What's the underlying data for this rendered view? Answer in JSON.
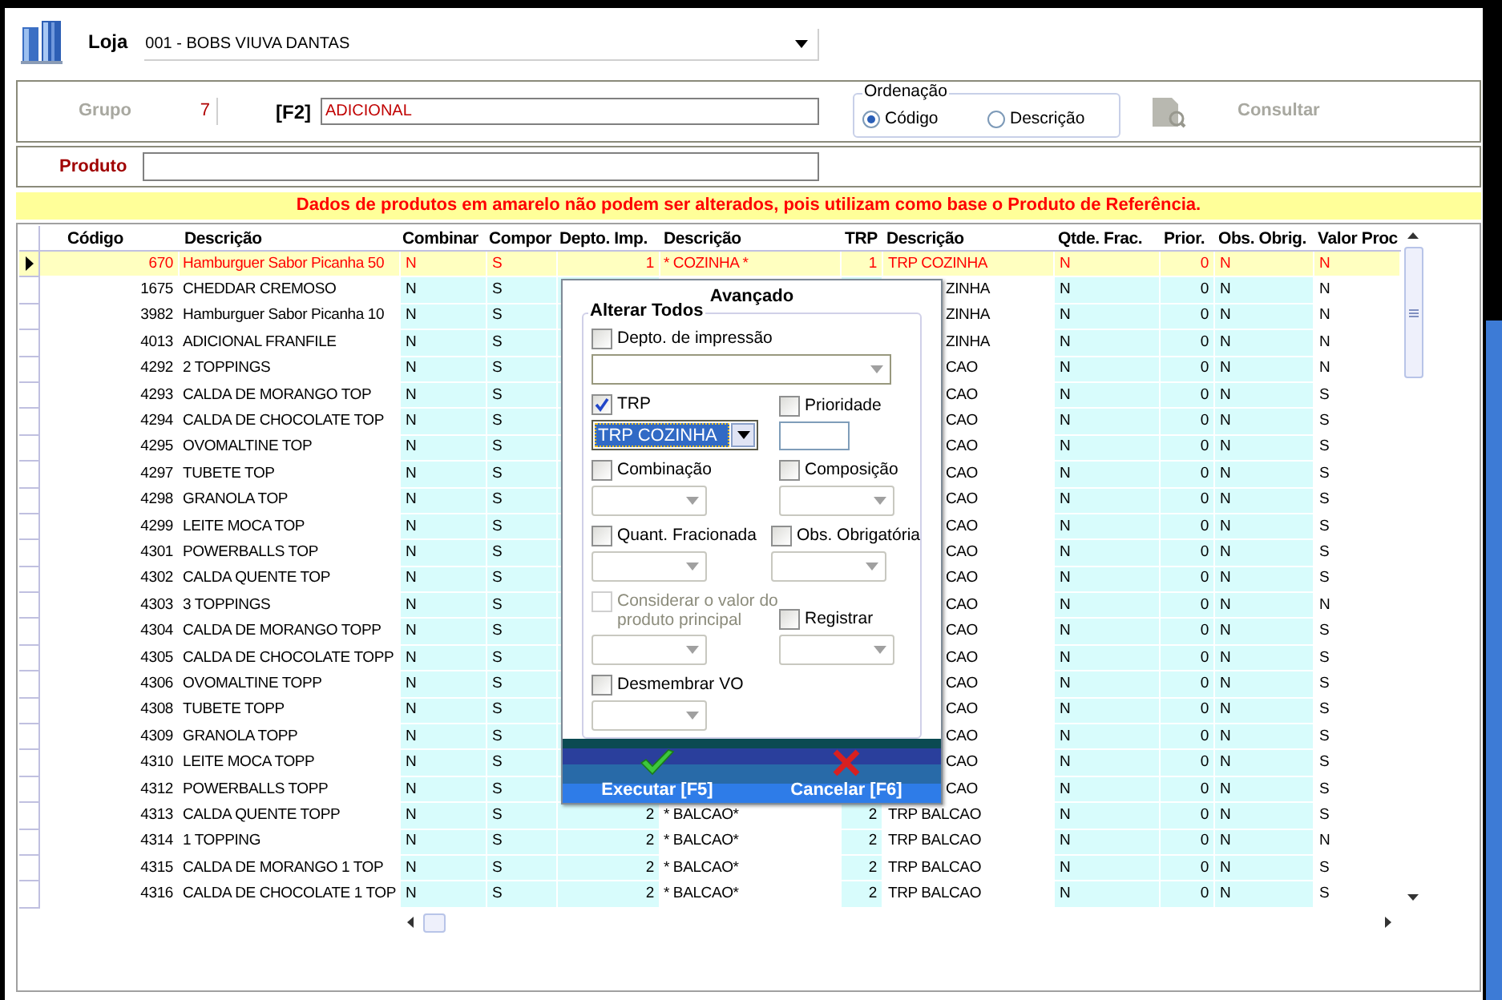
{
  "store": {
    "label": "Loja",
    "value": "001 - BOBS VIUVA DANTAS"
  },
  "filter": {
    "group_label": "Grupo",
    "group_value": "7",
    "shortcut": "[F2]",
    "group_name": "ADICIONAL",
    "ordering": {
      "title": "Ordenação",
      "options": [
        {
          "label": "Código",
          "selected": true
        },
        {
          "label": "Descrição",
          "selected": false
        }
      ]
    },
    "consult": {
      "label": "Consultar",
      "disabled": true
    }
  },
  "product": {
    "label": "Produto"
  },
  "notice": "Dados de produtos em amarelo não podem ser alterados, pois utilizam como base o Produto de Referência.",
  "grid": {
    "columns": [
      "Código",
      "Descrição",
      "Combinar",
      "Compor",
      "Depto. Imp.",
      "Descrição",
      "TRP",
      "Descrição",
      "Qtde. Frac.",
      "Prior.",
      "Obs. Obrig.",
      "Valor Proc"
    ],
    "rows": [
      {
        "selected": true,
        "covered": false,
        "codigo": "670",
        "descricao": "Hamburguer Sabor Picanha 50",
        "combinar": "N",
        "compor": "S",
        "depto_imp": "1",
        "depto_desc": "* COZINHA *",
        "trp": "1",
        "trp_desc": "TRP COZINHA",
        "qtde_frac": "N",
        "prior": "0",
        "obs_obrig": "N",
        "valor_proc": "N"
      },
      {
        "selected": false,
        "covered": true,
        "codigo": "1675",
        "descricao": "CHEDDAR CREMOSO",
        "combinar": "N",
        "compor": "S",
        "trp_desc": "ZINHA",
        "qtde_frac": "N",
        "prior": "0",
        "obs_obrig": "N",
        "valor_proc": "N"
      },
      {
        "selected": false,
        "covered": true,
        "codigo": "3982",
        "descricao": "Hamburguer Sabor Picanha 10",
        "combinar": "N",
        "compor": "S",
        "trp_desc": "ZINHA",
        "qtde_frac": "N",
        "prior": "0",
        "obs_obrig": "N",
        "valor_proc": "N"
      },
      {
        "selected": false,
        "covered": true,
        "codigo": "4013",
        "descricao": "ADICIONAL FRANFILE",
        "combinar": "N",
        "compor": "S",
        "trp_desc": "ZINHA",
        "qtde_frac": "N",
        "prior": "0",
        "obs_obrig": "N",
        "valor_proc": "N"
      },
      {
        "selected": false,
        "covered": true,
        "codigo": "4292",
        "descricao": "2 TOPPINGS",
        "combinar": "N",
        "compor": "S",
        "trp_desc": "CAO",
        "qtde_frac": "N",
        "prior": "0",
        "obs_obrig": "N",
        "valor_proc": "N"
      },
      {
        "selected": false,
        "covered": true,
        "codigo": "4293",
        "descricao": "CALDA DE MORANGO TOP",
        "combinar": "N",
        "compor": "S",
        "trp_desc": "CAO",
        "qtde_frac": "N",
        "prior": "0",
        "obs_obrig": "N",
        "valor_proc": "S"
      },
      {
        "selected": false,
        "covered": true,
        "codigo": "4294",
        "descricao": "CALDA DE CHOCOLATE TOP",
        "combinar": "N",
        "compor": "S",
        "trp_desc": "CAO",
        "qtde_frac": "N",
        "prior": "0",
        "obs_obrig": "N",
        "valor_proc": "S"
      },
      {
        "selected": false,
        "covered": true,
        "codigo": "4295",
        "descricao": "OVOMALTINE TOP",
        "combinar": "N",
        "compor": "S",
        "trp_desc": "CAO",
        "qtde_frac": "N",
        "prior": "0",
        "obs_obrig": "N",
        "valor_proc": "S"
      },
      {
        "selected": false,
        "covered": true,
        "codigo": "4297",
        "descricao": "TUBETE TOP",
        "combinar": "N",
        "compor": "S",
        "trp_desc": "CAO",
        "qtde_frac": "N",
        "prior": "0",
        "obs_obrig": "N",
        "valor_proc": "S"
      },
      {
        "selected": false,
        "covered": true,
        "codigo": "4298",
        "descricao": "GRANOLA TOP",
        "combinar": "N",
        "compor": "S",
        "trp_desc": "CAO",
        "qtde_frac": "N",
        "prior": "0",
        "obs_obrig": "N",
        "valor_proc": "S"
      },
      {
        "selected": false,
        "covered": true,
        "codigo": "4299",
        "descricao": "LEITE MOCA TOP",
        "combinar": "N",
        "compor": "S",
        "trp_desc": "CAO",
        "qtde_frac": "N",
        "prior": "0",
        "obs_obrig": "N",
        "valor_proc": "S"
      },
      {
        "selected": false,
        "covered": true,
        "codigo": "4301",
        "descricao": "POWERBALLS TOP",
        "combinar": "N",
        "compor": "S",
        "trp_desc": "CAO",
        "qtde_frac": "N",
        "prior": "0",
        "obs_obrig": "N",
        "valor_proc": "S"
      },
      {
        "selected": false,
        "covered": true,
        "codigo": "4302",
        "descricao": "CALDA QUENTE TOP",
        "combinar": "N",
        "compor": "S",
        "trp_desc": "CAO",
        "qtde_frac": "N",
        "prior": "0",
        "obs_obrig": "N",
        "valor_proc": "S"
      },
      {
        "selected": false,
        "covered": true,
        "codigo": "4303",
        "descricao": "3 TOPPINGS",
        "combinar": "N",
        "compor": "S",
        "trp_desc": "CAO",
        "qtde_frac": "N",
        "prior": "0",
        "obs_obrig": "N",
        "valor_proc": "N"
      },
      {
        "selected": false,
        "covered": true,
        "codigo": "4304",
        "descricao": "CALDA DE MORANGO TOPP",
        "combinar": "N",
        "compor": "S",
        "trp_desc": "CAO",
        "qtde_frac": "N",
        "prior": "0",
        "obs_obrig": "N",
        "valor_proc": "S"
      },
      {
        "selected": false,
        "covered": true,
        "codigo": "4305",
        "descricao": "CALDA DE CHOCOLATE TOPP",
        "combinar": "N",
        "compor": "S",
        "trp_desc": "CAO",
        "qtde_frac": "N",
        "prior": "0",
        "obs_obrig": "N",
        "valor_proc": "S"
      },
      {
        "selected": false,
        "covered": true,
        "codigo": "4306",
        "descricao": "OVOMALTINE TOPP",
        "combinar": "N",
        "compor": "S",
        "trp_desc": "CAO",
        "qtde_frac": "N",
        "prior": "0",
        "obs_obrig": "N",
        "valor_proc": "S"
      },
      {
        "selected": false,
        "covered": true,
        "codigo": "4308",
        "descricao": "TUBETE TOPP",
        "combinar": "N",
        "compor": "S",
        "trp_desc": "CAO",
        "qtde_frac": "N",
        "prior": "0",
        "obs_obrig": "N",
        "valor_proc": "S"
      },
      {
        "selected": false,
        "covered": true,
        "codigo": "4309",
        "descricao": "GRANOLA TOPP",
        "combinar": "N",
        "compor": "S",
        "trp_desc": "CAO",
        "qtde_frac": "N",
        "prior": "0",
        "obs_obrig": "N",
        "valor_proc": "S"
      },
      {
        "selected": false,
        "covered": true,
        "codigo": "4310",
        "descricao": "LEITE MOCA TOPP",
        "combinar": "N",
        "compor": "S",
        "trp_desc": "CAO",
        "qtde_frac": "N",
        "prior": "0",
        "obs_obrig": "N",
        "valor_proc": "S"
      },
      {
        "selected": false,
        "covered": true,
        "codigo": "4312",
        "descricao": "POWERBALLS TOPP",
        "combinar": "N",
        "compor": "S",
        "trp_desc": "CAO",
        "qtde_frac": "N",
        "prior": "0",
        "obs_obrig": "N",
        "valor_proc": "S"
      },
      {
        "selected": false,
        "covered": false,
        "codigo": "4313",
        "descricao": "CALDA QUENTE TOPP",
        "combinar": "N",
        "compor": "S",
        "depto_imp": "2",
        "depto_desc": "* BALCAO*",
        "trp": "2",
        "trp_desc": "TRP BALCAO",
        "qtde_frac": "N",
        "prior": "0",
        "obs_obrig": "N",
        "valor_proc": "S"
      },
      {
        "selected": false,
        "covered": false,
        "codigo": "4314",
        "descricao": "1 TOPPING",
        "combinar": "N",
        "compor": "S",
        "depto_imp": "2",
        "depto_desc": "* BALCAO*",
        "trp": "2",
        "trp_desc": "TRP BALCAO",
        "qtde_frac": "N",
        "prior": "0",
        "obs_obrig": "N",
        "valor_proc": "N"
      },
      {
        "selected": false,
        "covered": false,
        "codigo": "4315",
        "descricao": "CALDA DE MORANGO 1 TOP",
        "combinar": "N",
        "compor": "S",
        "depto_imp": "2",
        "depto_desc": "* BALCAO*",
        "trp": "2",
        "trp_desc": "TRP BALCAO",
        "qtde_frac": "N",
        "prior": "0",
        "obs_obrig": "N",
        "valor_proc": "S"
      },
      {
        "selected": false,
        "covered": false,
        "codigo": "4316",
        "descricao": "CALDA DE CHOCOLATE 1 TOP",
        "combinar": "N",
        "compor": "S",
        "depto_imp": "2",
        "depto_desc": "* BALCAO*",
        "trp": "2",
        "trp_desc": "TRP BALCAO",
        "qtde_frac": "N",
        "prior": "0",
        "obs_obrig": "N",
        "valor_proc": "S"
      }
    ]
  },
  "dialog": {
    "title": "Avançado",
    "group_title": "Alterar Todos",
    "option_rows": [
      [
        {
          "label": "Depto. de impressão",
          "checked": false,
          "disabled": false,
          "kind": "wide-select"
        }
      ],
      [
        {
          "label": "TRP",
          "checked": true,
          "disabled": false,
          "kind": "select",
          "value": "TRP COZINHA",
          "focused": true
        },
        {
          "label": "Prioridade",
          "checked": false,
          "disabled": false,
          "kind": "input"
        }
      ],
      [
        {
          "label": "Combinação",
          "checked": false,
          "disabled": false,
          "kind": "select"
        },
        {
          "label": "Composição",
          "checked": false,
          "disabled": false,
          "kind": "select"
        }
      ],
      [
        {
          "label": "Quant. Fracionada",
          "checked": false,
          "disabled": false,
          "kind": "select"
        },
        {
          "label": "Obs. Obrigatória",
          "checked": false,
          "disabled": false,
          "kind": "select"
        }
      ],
      [
        {
          "label": "Considerar o valor do produto principal",
          "checked": false,
          "disabled": true,
          "kind": "select"
        },
        {
          "label": "Registrar",
          "checked": false,
          "disabled": false,
          "kind": "select"
        }
      ],
      [
        {
          "label": "Desmembrar VO",
          "checked": false,
          "disabled": false,
          "kind": "select"
        }
      ]
    ],
    "buttons": [
      {
        "label": "Executar [F5]",
        "kind": "confirm"
      },
      {
        "label": "Cancelar [F6]",
        "kind": "cancel"
      }
    ]
  }
}
